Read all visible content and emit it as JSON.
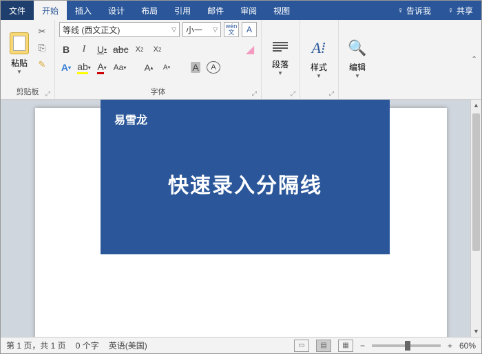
{
  "tabs": {
    "file": "文件",
    "home": "开始",
    "insert": "插入",
    "design": "设计",
    "layout": "布局",
    "references": "引用",
    "mail": "邮件",
    "review": "审阅",
    "view": "视图",
    "tellme": "告诉我",
    "share": "共享"
  },
  "clipboard": {
    "paste": "粘贴",
    "group": "剪贴板"
  },
  "font": {
    "name": "等线 (西文正文)",
    "size": "小一",
    "group": "字体",
    "wen": "wén",
    "bold": "B",
    "italic": "I",
    "underline": "U",
    "strike": "abc",
    "sub": "X",
    "sup": "X",
    "charA": "A",
    "Aa": "Aa",
    "Abig": "A",
    "Asmall": "A",
    "circleA": "A"
  },
  "groups": {
    "paragraph": "段落",
    "styles": "样式",
    "edit": "编辑"
  },
  "overlay": {
    "brand": "易雪龙",
    "title": "快速录入分隔线"
  },
  "status": {
    "page": "第 1 页，共 1 页",
    "words": "0 个字",
    "lang": "英语(美国)",
    "zoom": "60%"
  }
}
